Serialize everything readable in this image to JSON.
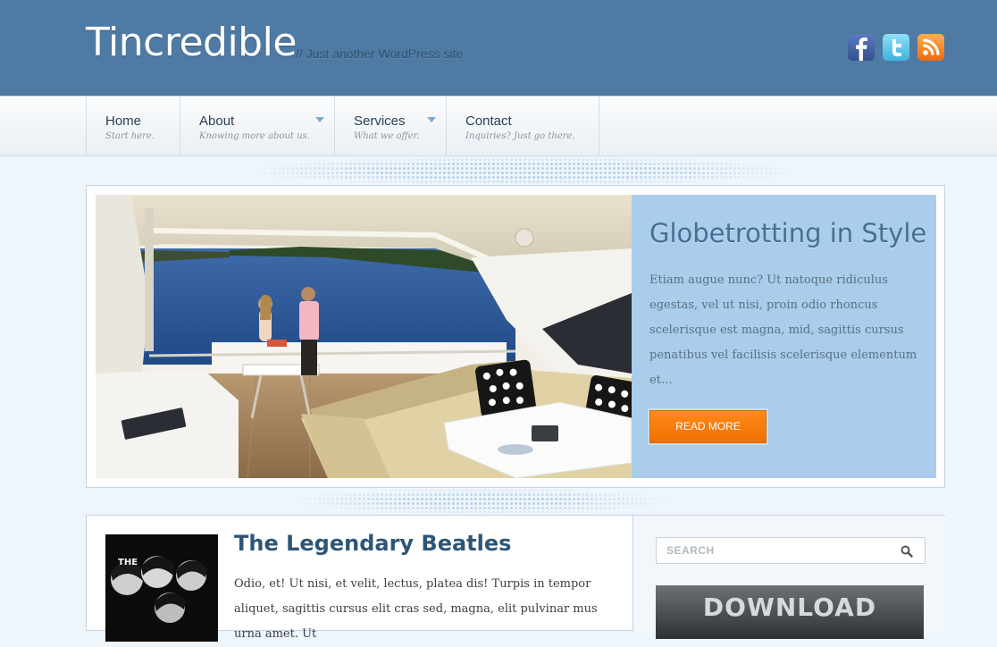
{
  "header": {
    "site_title": "Tincredible",
    "tagline": "// Just another WordPress site",
    "social": [
      {
        "name": "facebook-icon",
        "letter": "f",
        "color": "#3b5998"
      },
      {
        "name": "twitter-icon",
        "letter": "t",
        "color": "#55c3ea"
      },
      {
        "name": "rss-icon",
        "color": "#f2771e"
      }
    ]
  },
  "nav": {
    "items": [
      {
        "label": "Home",
        "sub": "Start here.",
        "has_dropdown": false
      },
      {
        "label": "About",
        "sub": "Knowing more about us.",
        "has_dropdown": true
      },
      {
        "label": "Services",
        "sub": "What we offer.",
        "has_dropdown": true
      },
      {
        "label": "Contact",
        "sub": "Inquiries? Just go there.",
        "has_dropdown": false
      }
    ]
  },
  "feature": {
    "title": "Globetrotting in Style",
    "text": "Etiam augue nunc? Ut natoque ridiculus egestas, vel ut nisi, proin odio rhoncus scelerisque est magna, mid, sagittis cursus penatibus vel facilisis scelerisque elementum et…",
    "button_label": "READ MORE",
    "panel_color": "#a9cdea",
    "button_color": "#f57c00"
  },
  "post": {
    "title": "The Legendary Beatles",
    "excerpt": "Odio, et! Ut nisi, et velit, lectus, platea dis! Turpis in tempor aliquet, sagittis cursus elit cras sed, magna, elit pulvinar mus urna amet. Ut",
    "thumb_text": "THE"
  },
  "sidebar": {
    "search_placeholder": "SEARCH",
    "banner_text": "DOWNLOAD"
  },
  "colors": {
    "header_bg": "#4f7aa3",
    "title_color": "#2f5575"
  }
}
